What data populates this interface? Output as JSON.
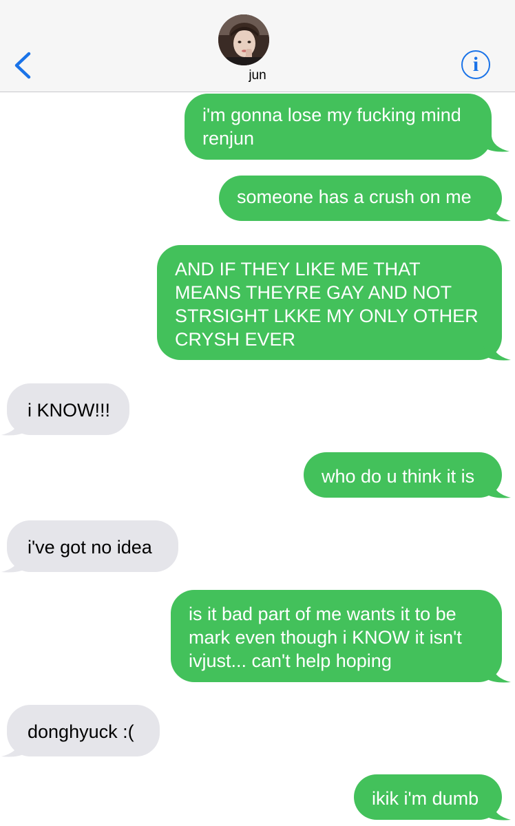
{
  "header": {
    "contact_name": "jun",
    "back_label": "<",
    "info_label": "i"
  },
  "colors": {
    "sent_bubble": "#43c15b",
    "received_bubble": "#e5e5ea",
    "accent": "#1a73e8",
    "header_bg": "#f6f6f6"
  },
  "messages": [
    {
      "from": "me",
      "text": "i'm gonna lose my fucking mind renjun"
    },
    {
      "from": "me",
      "text": "someone has a crush on me"
    },
    {
      "from": "me",
      "text": "AND IF THEY LIKE ME THAT MEANS THEYRE GAY AND NOT STRSIGHT LKKE MY ONLY OTHER CRYSH EVER"
    },
    {
      "from": "them",
      "text": "i KNOW!!!"
    },
    {
      "from": "me",
      "text": "who do u think it is"
    },
    {
      "from": "them",
      "text": "i've got no idea"
    },
    {
      "from": "me",
      "text": "is it bad part of me wants it to be mark even though i KNOW it isn't ivjust... can't help hoping"
    },
    {
      "from": "them",
      "text": "donghyuck :("
    },
    {
      "from": "me",
      "text": "ikik i'm dumb"
    }
  ]
}
